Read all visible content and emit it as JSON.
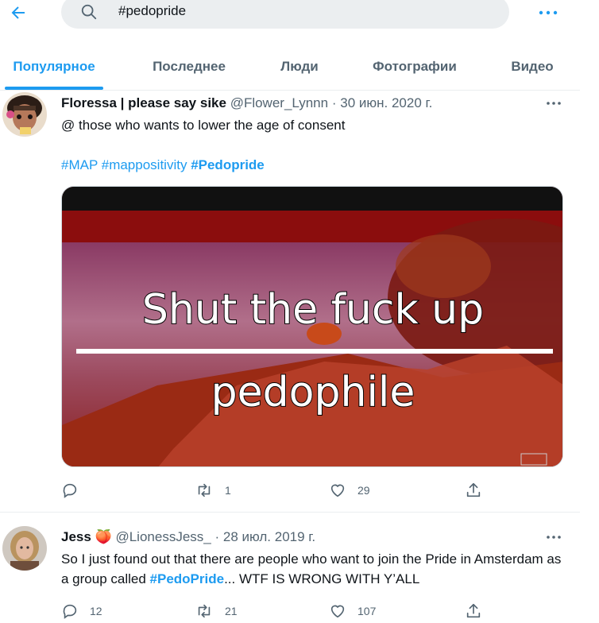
{
  "header": {
    "search_query": "#pedopride",
    "back_icon": "arrow-left-icon",
    "more_icon": "more-horizontal-icon"
  },
  "tabs": [
    {
      "label": "Популярное",
      "active": true
    },
    {
      "label": "Последнее",
      "active": false
    },
    {
      "label": "Люди",
      "active": false
    },
    {
      "label": "Фотографии",
      "active": false
    },
    {
      "label": "Видео",
      "active": false
    }
  ],
  "tweets": [
    {
      "name": "Floressa | please say sike",
      "handle": "@Flower_Lynnn",
      "separator": "·",
      "date": "30 июн. 2020 г.",
      "text_line1": "@ those who wants to lower the age of consent",
      "hashtags": [
        "#MAP",
        "#mappositivity",
        "#Pedopride"
      ],
      "media": {
        "line1": "Shut the fuck up",
        "line2": "pedophile"
      },
      "stats": {
        "replies": "",
        "retweets": "1",
        "likes": "29"
      }
    },
    {
      "name": "Jess",
      "name_emoji": "🍑",
      "handle": "@LionessJess_",
      "separator": "·",
      "date": "28 июл. 2019 г.",
      "text_before": "So I just found out that there are people who want to join the Pride in Amsterdam as a group called ",
      "text_tag": "#PedoPride",
      "text_after": "... WTF IS WRONG WITH Y’ALL",
      "stats": {
        "replies": "12",
        "retweets": "21",
        "likes": "107"
      }
    }
  ],
  "colors": {
    "accent": "#1d9bf0",
    "secondary_text": "#536471",
    "primary_text": "#0f1419",
    "search_bg": "#ebeef0"
  }
}
